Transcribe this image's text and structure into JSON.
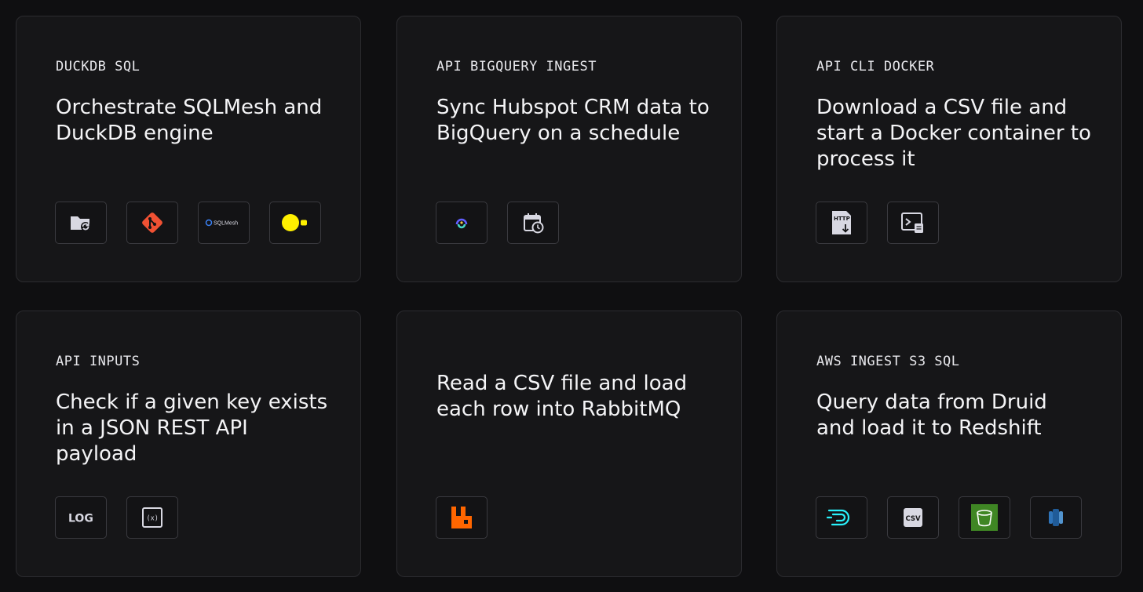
{
  "cards": [
    {
      "tags": "DUCKDB SQL",
      "title": "Orchestrate SQLMesh and DuckDB engine",
      "icons": [
        "folder-sync-icon",
        "git-icon",
        "sqlmesh-logo-icon",
        "duckdb-logo-icon"
      ],
      "sqlmesh_text": "SQLMesh"
    },
    {
      "tags": "API BIGQUERY INGEST",
      "title": "Sync Hubspot CRM data to BigQuery on a schedule",
      "icons": [
        "airbyte-logo-icon",
        "calendar-clock-icon"
      ]
    },
    {
      "tags": "API CLI DOCKER",
      "title": "Download a CSV file and start a Docker container to process it",
      "icons": [
        "http-download-icon",
        "terminal-script-icon"
      ],
      "http_text": "HTTP"
    },
    {
      "tags": "API INPUTS",
      "title": "Check if a given key exists in a JSON REST API payload",
      "icons": [
        "log-icon",
        "variable-icon"
      ],
      "log_text": "LOG",
      "variable_text": "(x)"
    },
    {
      "tags": "",
      "title": "Read a CSV file and load each row into RabbitMQ",
      "icons": [
        "rabbitmq-logo-icon"
      ]
    },
    {
      "tags": "AWS INGEST S3 SQL",
      "title": "Query data from Druid and load it to Redshift",
      "icons": [
        "druid-logo-icon",
        "csv-icon",
        "s3-bucket-icon",
        "redshift-logo-icon"
      ],
      "csv_text": "CSV"
    }
  ],
  "colors": {
    "background": "#0f0f11",
    "card": "#161618",
    "border": "#2c2c30",
    "git": "#f05133",
    "duckdb": "#fff000",
    "rabbitmq": "#ff6600",
    "druid": "#29f1fb",
    "s3": "#3f8624",
    "redshift": "#2e73b8"
  }
}
